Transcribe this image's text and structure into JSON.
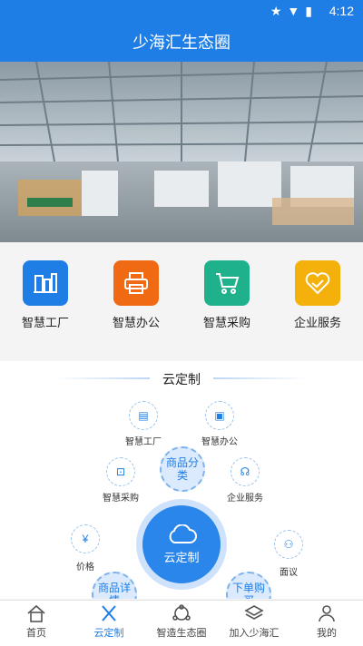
{
  "status": {
    "time": "4:12",
    "icons": [
      "star-icon",
      "wifi-icon",
      "battery-icon"
    ]
  },
  "header": {
    "title": "少海汇生态圈"
  },
  "quick_links": [
    {
      "label": "智慧工厂",
      "icon": "factory-icon",
      "color": "#1e7ee6"
    },
    {
      "label": "智慧办公",
      "icon": "printer-icon",
      "color": "#f06a13"
    },
    {
      "label": "智慧采购",
      "icon": "cart-icon",
      "color": "#1fb08c"
    },
    {
      "label": "企业服务",
      "icon": "handshake-icon",
      "color": "#f4b10c"
    }
  ],
  "cloud": {
    "title": "云定制",
    "nodes": {
      "factory": "智慧工厂",
      "office": "智慧办公",
      "purchase": "智慧采购",
      "service": "企业服务",
      "price": "价格",
      "meeting": "面议"
    },
    "bubbles": {
      "category": "商品分类",
      "detail": "商品详情",
      "order": "下单购买"
    },
    "center_label": "云定制",
    "price_icon_text": "¥"
  },
  "tabs": [
    {
      "label": "首页",
      "active": false
    },
    {
      "label": "云定制",
      "active": true
    },
    {
      "label": "智造生态圈",
      "active": false
    },
    {
      "label": "加入少海汇",
      "active": false
    },
    {
      "label": "我的",
      "active": false
    }
  ],
  "colors": {
    "primary": "#1e7ee6"
  }
}
